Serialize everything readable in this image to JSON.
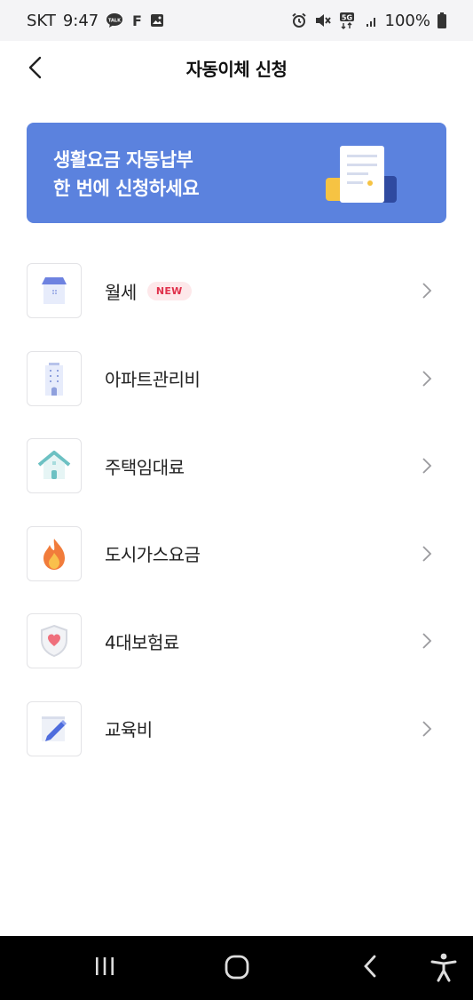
{
  "status_bar": {
    "carrier": "SKT",
    "time": "9:47",
    "talk_badge": "TALK",
    "f_glyph": "F",
    "network": "5G",
    "battery": "100%",
    "icons": [
      "chat-talk-icon",
      "f-app-icon",
      "image-icon",
      "alarm-icon",
      "mute-icon",
      "network-5g-icon",
      "signal-icon",
      "battery-icon"
    ]
  },
  "header": {
    "title": "자동이체 신청",
    "back_icon": "back-arrow-icon"
  },
  "banner": {
    "line1": "생활요금 자동납부",
    "line2": "한 번에 신청하세요",
    "color": "#5b82de"
  },
  "items": [
    {
      "label": "월세",
      "badge": "NEW",
      "icon": "house-icon"
    },
    {
      "label": "아파트관리비",
      "icon": "apartment-building-icon"
    },
    {
      "label": "주택임대료",
      "icon": "home-rent-icon"
    },
    {
      "label": "도시가스요금",
      "icon": "flame-icon"
    },
    {
      "label": "4대보험료",
      "icon": "shield-heart-icon"
    },
    {
      "label": "교육비",
      "icon": "notebook-pencil-icon"
    }
  ],
  "nav": {
    "icons": [
      "recent-apps-icon",
      "home-icon",
      "back-icon",
      "accessibility-icon"
    ]
  },
  "colors": {
    "accent": "#5b82de",
    "badge_text": "#e0314b",
    "badge_bg": "#fde8ea"
  }
}
